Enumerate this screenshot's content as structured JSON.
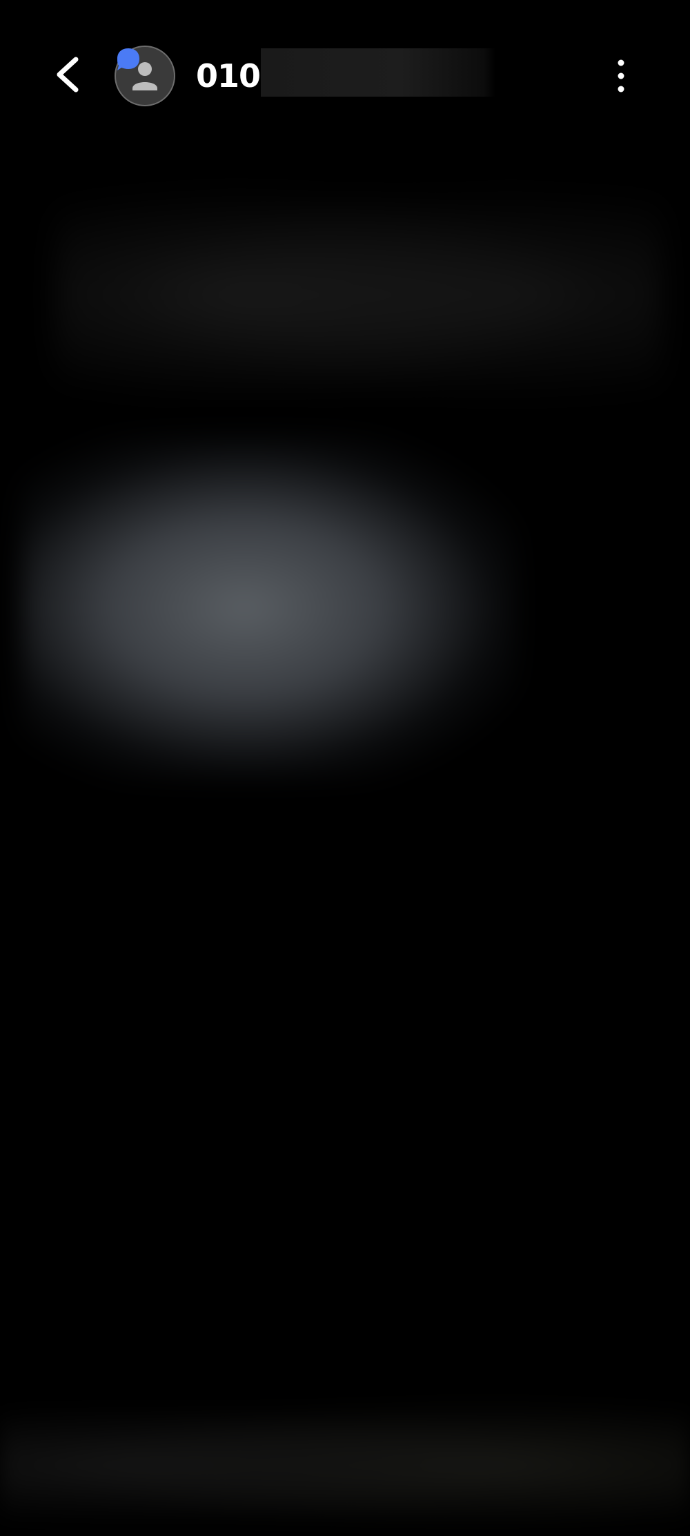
{
  "header": {
    "back_icon": "chevron-left-icon",
    "avatar_icon": "person-icon",
    "badge_icon": "chat-bubble-icon",
    "title": "010-",
    "more_icon": "more-vertical-icon"
  },
  "colors": {
    "background": "#000000",
    "badge": "#4b7bf5",
    "avatar_bg": "#3a3a3a",
    "icon": "#ffffff"
  }
}
